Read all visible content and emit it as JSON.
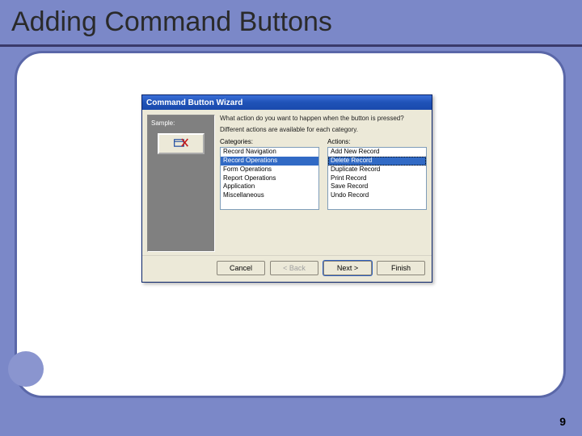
{
  "slide": {
    "title": "Adding Command Buttons",
    "page_number": "9"
  },
  "dialog": {
    "title": "Command Button Wizard",
    "sample_label": "Sample:",
    "prompt1": "What action do you want to happen when the button is pressed?",
    "prompt2": "Different actions are available for each category.",
    "categories_label": "Categories:",
    "actions_label": "Actions:",
    "categories": [
      "Record Navigation",
      "Record Operations",
      "Form Operations",
      "Report Operations",
      "Application",
      "Miscellaneous"
    ],
    "categories_selected_index": 1,
    "actions": [
      "Add New Record",
      "Delete Record",
      "Duplicate Record",
      "Print Record",
      "Save Record",
      "Undo Record"
    ],
    "actions_selected_index": 1,
    "buttons": {
      "cancel": "Cancel",
      "back": "< Back",
      "next": "Next >",
      "finish": "Finish"
    }
  }
}
